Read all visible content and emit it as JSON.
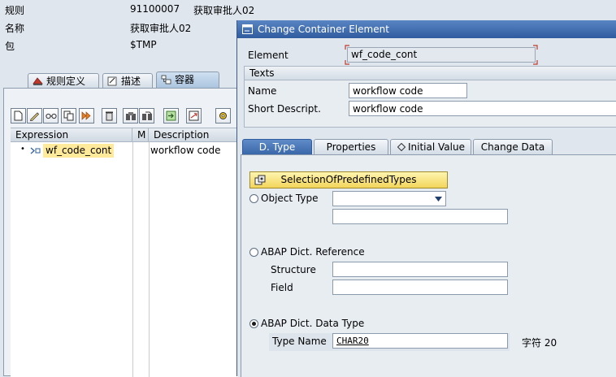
{
  "header": {
    "rule_label": "规则",
    "rule_value": "91100007",
    "rule_extra": "获取审批人02",
    "name_label": "名称",
    "name_value": "获取审批人02",
    "package_label": "包",
    "package_value": "$TMP"
  },
  "left_tabs": [
    {
      "label": "规则定义",
      "icon": "rule-definition-icon"
    },
    {
      "label": "描述",
      "icon": "description-icon"
    },
    {
      "label": "容器",
      "icon": "container-icon"
    }
  ],
  "toolbar": {
    "buttons": [
      "create-icon",
      "edit-icon",
      "glasses-icon",
      "copy-icon",
      "where-used-icon",
      "delete-icon",
      "search-icon",
      "search-next-icon",
      "import-icon",
      "export-icon",
      "settings-icon"
    ]
  },
  "tree": {
    "columns": [
      "Expression",
      "M",
      "Description"
    ],
    "rows": [
      {
        "expression": "wf_code_cont",
        "description": "workflow code"
      }
    ]
  },
  "dialog": {
    "title": "Change Container Element",
    "element_label": "Element",
    "element_value": "wf_code_cont",
    "texts_group": "Texts",
    "name_label": "Name",
    "name_value": "workflow code",
    "short_desc_label": "Short Descript.",
    "short_desc_value": "workflow code",
    "tabs": [
      "D. Type",
      "Properties",
      "Initial Value",
      "Change Data"
    ],
    "selection_button": "SelectionOfPredefinedTypes",
    "object_type_label": "Object Type",
    "object_type_value": "",
    "object_type_extra": "",
    "abap_ref_label": "ABAP Dict. Reference",
    "structure_label": "Structure",
    "structure_value": "",
    "field_label": "Field",
    "field_value": "",
    "abap_type_label": "ABAP Dict. Data Type",
    "type_name_label": "Type Name",
    "type_name_value": "CHAR20",
    "type_desc": "字符 20"
  },
  "colors": {
    "titlebar": "#2f5c9f",
    "highlight": "#ffe99a",
    "required_marker": "#c0392b"
  }
}
